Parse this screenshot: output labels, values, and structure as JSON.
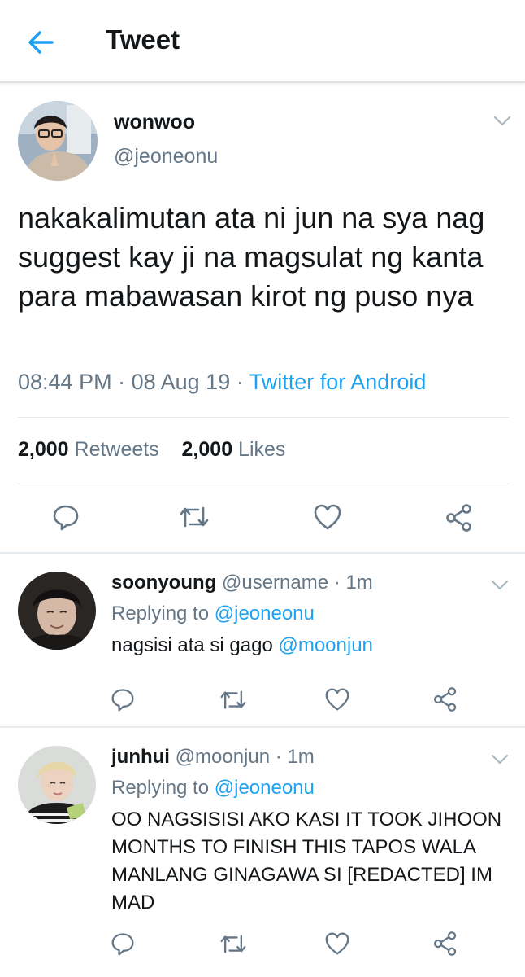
{
  "header": {
    "title": "Tweet",
    "back_icon": "arrow-left-icon"
  },
  "colors": {
    "accent": "#1da1f2",
    "secondary_text": "#657786",
    "divider": "#e1e8ed"
  },
  "main_tweet": {
    "name": "wonwoo",
    "handle": "@jeoneonu",
    "text": "nakakalimutan ata ni jun na sya nag suggest kay ji na magsulat ng kanta para mabawasan kirot ng puso nya",
    "time": "08:44 PM",
    "date": "08 Aug 19",
    "source": "Twitter for Android",
    "retweets_count": "2,000",
    "retweets_label": "Retweets",
    "likes_count": "2,000",
    "likes_label": "Likes"
  },
  "replies": [
    {
      "name": "soonyoung",
      "handle": "@username",
      "time": "1m",
      "replying_label": "Replying to",
      "replying_to": "@jeoneonu",
      "text": "nagsisi ata si gago",
      "mention": "@moonjun"
    },
    {
      "name": "junhui",
      "handle": "@moonjun",
      "time": "1m",
      "replying_label": "Replying to",
      "replying_to": "@jeoneonu",
      "text": "OO NAGSISISI AKO KASI IT TOOK JIHOON MONTHS TO FINISH THIS TAPOS WALA MANLANG GINAGAWA SI [REDACTED] IM MAD"
    }
  ]
}
